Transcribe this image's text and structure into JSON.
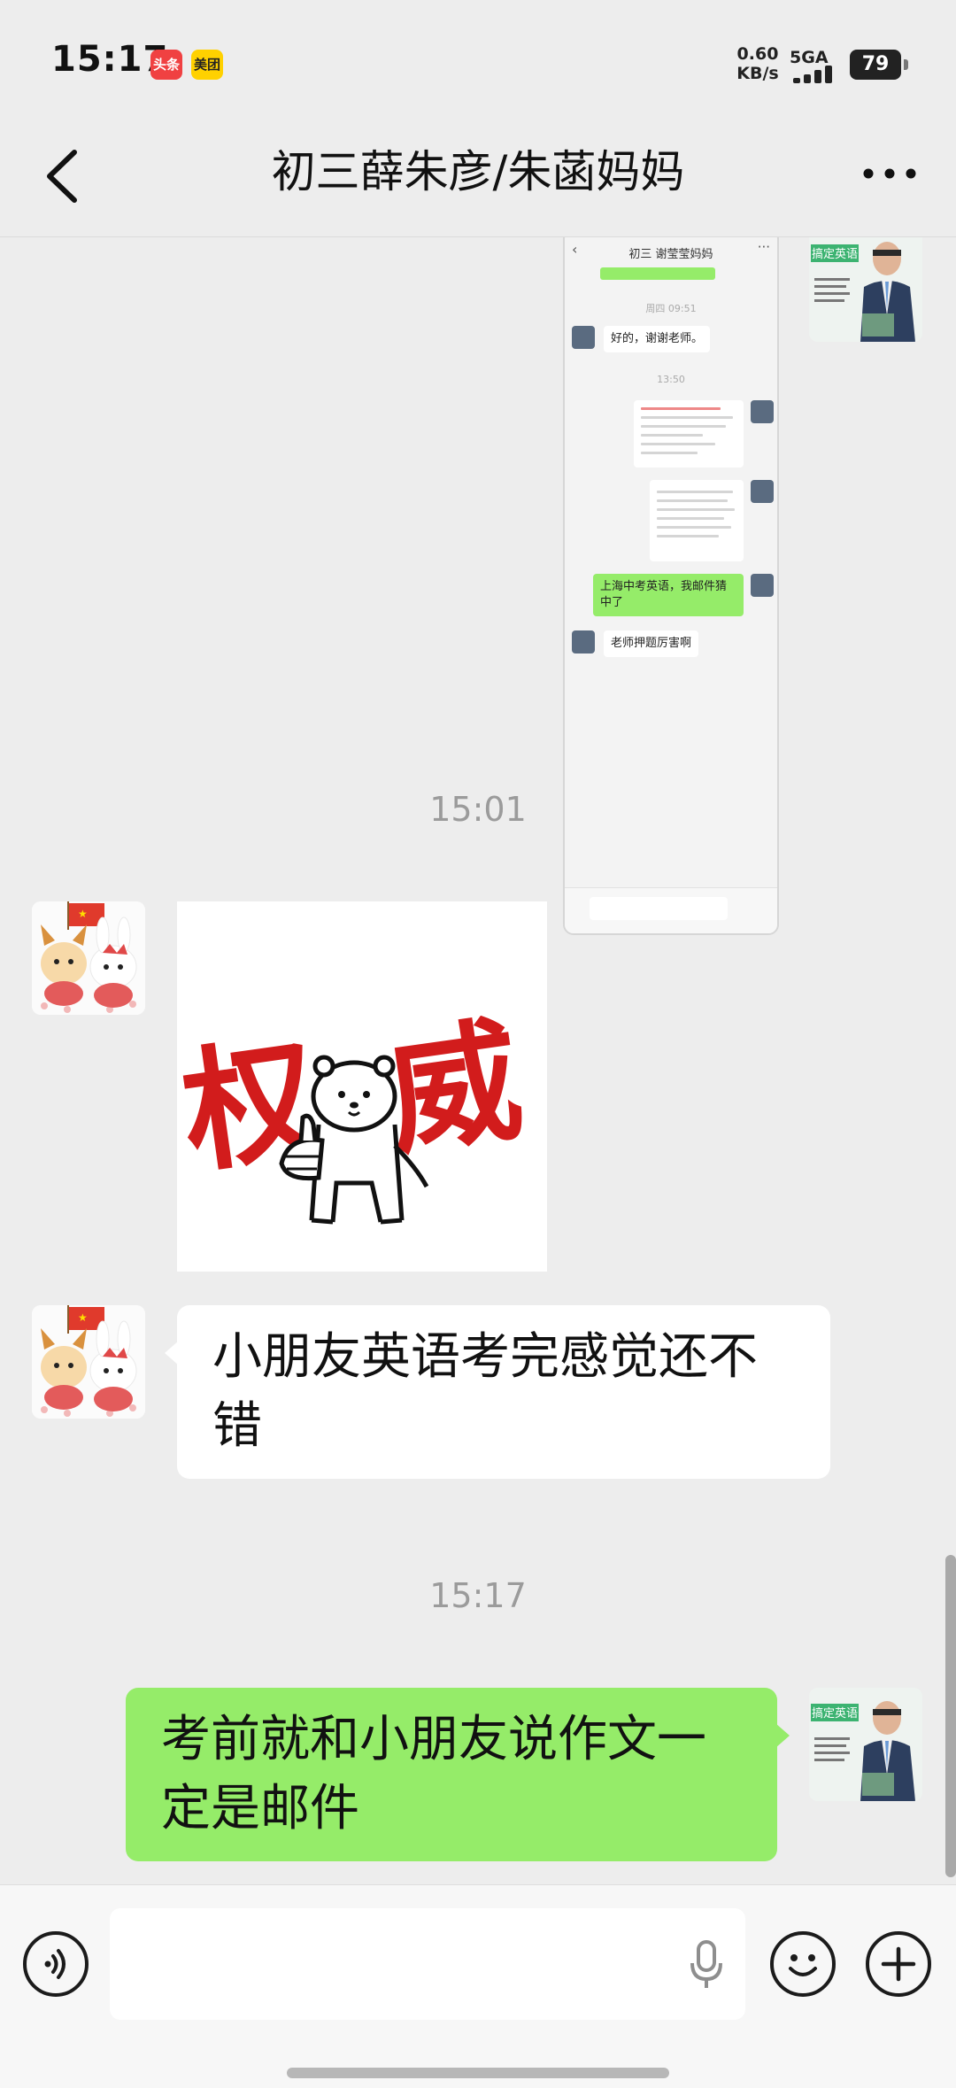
{
  "status_bar": {
    "time": "15:17",
    "app_badges": [
      "头条",
      "美团"
    ],
    "network_speed_value": "0.60",
    "network_speed_unit": "KB/s",
    "network_type": "5GA",
    "battery": "79"
  },
  "nav": {
    "title": "初三薛朱彦/朱菡妈妈",
    "back_icon": "chevron-left-icon",
    "more_icon": "more-horizontal-icon"
  },
  "embedded_screenshot": {
    "title": "初三 谢莹莹妈妈",
    "time_1": "周四 09:51",
    "reply_1": "好的，谢谢老师。",
    "time_2": "13:50",
    "reply_green": "上海中考英语，我邮件猜中了",
    "reply_2": "老师押题厉害啊"
  },
  "teacher_avatar": {
    "caption": "搞定英语"
  },
  "messages": [
    {
      "type": "timestamp",
      "text": "15:01"
    },
    {
      "type": "sticker",
      "side": "left",
      "text": "权威"
    },
    {
      "type": "text",
      "side": "left",
      "text": "小朋友英语考完感觉还不错"
    },
    {
      "type": "timestamp",
      "text": "15:17"
    },
    {
      "type": "text",
      "side": "right",
      "text": "考前就和小朋友说作文一定是邮件"
    }
  ],
  "input_bar": {
    "voice_icon": "voice-mode-icon",
    "mic_icon": "microphone-icon",
    "emoji_icon": "emoji-icon",
    "plus_icon": "plus-icon"
  },
  "colors": {
    "background": "#ededed",
    "bubble_right": "#95ec69",
    "bubble_left": "#ffffff",
    "timestamp": "#9b9b9b"
  }
}
